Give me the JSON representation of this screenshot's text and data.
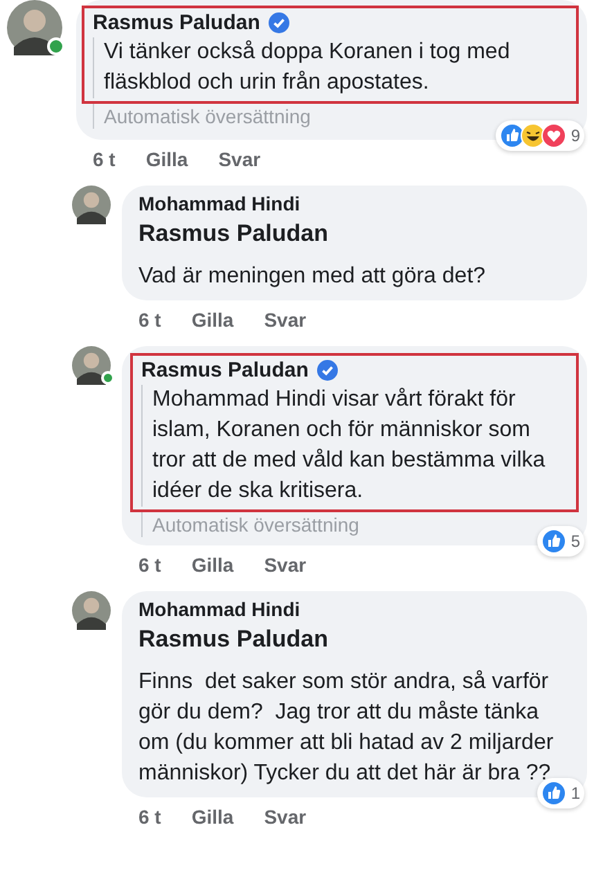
{
  "comments": [
    {
      "author": "Rasmus Paludan",
      "verified": true,
      "online": true,
      "highlighted": true,
      "text": "Vi tänker också doppa Koranen i tog med fläskblod och urin från apostates.",
      "translation": "Automatisk översättning",
      "time": "6 t",
      "actions": [
        "Gilla",
        "Svar"
      ],
      "reactions": [
        {
          "kind": "like"
        },
        {
          "kind": "haha"
        },
        {
          "kind": "love"
        }
      ],
      "reaction_count": "9",
      "children": [
        {
          "author": "Mohammad Hindi",
          "verified": false,
          "online": false,
          "highlighted": false,
          "mention": "Rasmus Paludan",
          "text": "Vad är meningen med att göra det?",
          "time": "6 t",
          "actions": [
            "Gilla",
            "Svar"
          ]
        },
        {
          "author": "Rasmus Paludan",
          "verified": true,
          "online": true,
          "highlighted": true,
          "text": "Mohammad Hindi visar vårt förakt för islam, Koranen och för människor som tror att de med våld kan bestämma vilka idéer de ska kritisera.",
          "translation": "Automatisk översättning",
          "time": "6 t",
          "actions": [
            "Gilla",
            "Svar"
          ],
          "reactions": [
            {
              "kind": "like"
            }
          ],
          "reaction_count": "5"
        },
        {
          "author": "Mohammad Hindi",
          "verified": false,
          "online": false,
          "highlighted": false,
          "mention": "Rasmus Paludan",
          "text": "Finns  det saker som stör andra, så varför gör du dem?  Jag tror att du måste tänka om (du kommer att bli hatad av 2 miljarder människor) Tycker du att det här är bra ??",
          "time": "6 t",
          "actions": [
            "Gilla",
            "Svar"
          ],
          "reactions": [
            {
              "kind": "like"
            }
          ],
          "reaction_count": "1"
        }
      ]
    }
  ]
}
